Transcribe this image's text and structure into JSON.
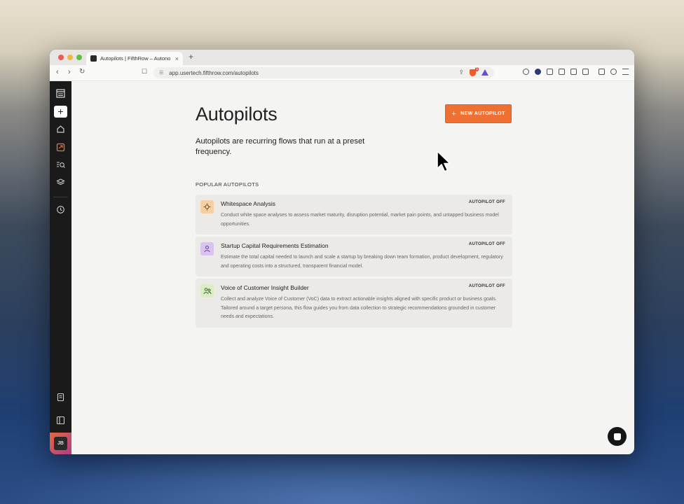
{
  "browser": {
    "tab_title": "Autopilots | FifthRow – Autono",
    "tab_close": "×",
    "new_tab": "+",
    "url": "app.usertech.fifthrow.com/autopilots",
    "notification_count": "1"
  },
  "sidebar": {
    "items": [
      {
        "icon": "menu-icon"
      },
      {
        "icon": "plus-icon",
        "label": "+"
      },
      {
        "icon": "home-icon"
      },
      {
        "icon": "autopilot-icon"
      },
      {
        "icon": "search-list-icon"
      },
      {
        "icon": "layers-icon"
      },
      {
        "icon": "clock-icon"
      },
      {
        "icon": "document-icon"
      },
      {
        "icon": "panel-icon"
      }
    ],
    "avatar_initials": "JB",
    "accent_color": "#f07034"
  },
  "page": {
    "title": "Autopilots",
    "new_button_label": "NEW AUTOPILOT",
    "new_button_plus": "+",
    "subtitle": "Autopilots are recurring flows that run at a preset frequency.",
    "section_label": "POPULAR AUTOPILOTS"
  },
  "autopilots": [
    {
      "title": "Whitespace Analysis",
      "status": "AUTOPILOT OFF",
      "description": "Conduct white space analyses to assess market maturity, disruption potential, market pain points, and untapped business model opportunities.",
      "icon": "target-icon",
      "icon_bg": "#f6cfa5"
    },
    {
      "title": "Startup Capital Requirements Estimation",
      "status": "AUTOPILOT OFF",
      "description": "Estimate the total capital needed to launch and scale a startup by breaking down team formation, product development, regulatory and operating costs into a structured, transparent financial model.",
      "icon": "person-icon",
      "icon_bg": "#d9c4f0"
    },
    {
      "title": "Voice of Customer Insight Builder",
      "status": "AUTOPILOT OFF",
      "description": "Collect and analyze Voice of Customer (VoC) data to extract actionable insights aligned with specific product or business goals. Tailored around a target persona, this flow guides you from data collection to strategic recommendations grounded in customer needs and expectations.",
      "icon": "people-icon",
      "icon_bg": "#dbecc8"
    }
  ]
}
